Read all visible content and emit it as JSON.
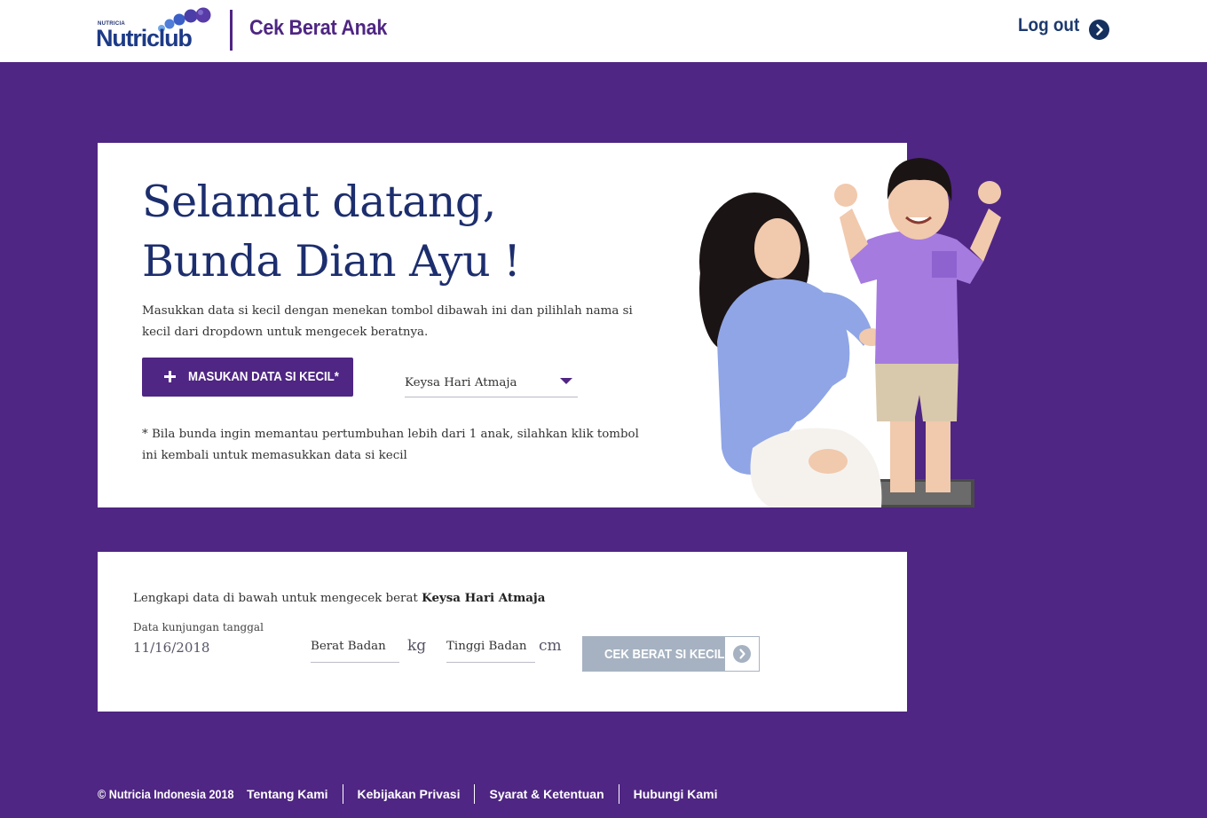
{
  "header": {
    "logo_small": "NUTRICIA",
    "logo_text": "Nutriclub",
    "title": "Cek Berat Anak",
    "logout_label": "Log out",
    "logout_icon": "chevron-right-circle-icon"
  },
  "welcome": {
    "greeting_line1": "Selamat datang,",
    "greeting_line2": "Bunda Dian Ayu !",
    "intro": "Masukkan data si kecil dengan menekan tombol dibawah ini dan pilihlah nama si kecil dari dropdown untuk mengecek beratnya.",
    "add_button_label": "MASUKAN DATA SI KECIL*",
    "add_button_icon": "plus-icon",
    "child_select_value": "Keysa Hari Atmaja",
    "note": "* Bila bunda ingin memantau pertumbuhan lebih dari 1 anak, silahkan klik tombol ini kembali untuk memasukkan data si kecil"
  },
  "form": {
    "intro_prefix": "Lengkapi data di bawah untuk mengecek berat",
    "intro_child_name": "Keysa Hari Atmaja",
    "visit_date_label": "Data kunjungan tanggal",
    "visit_date_value": "11/16/2018",
    "weight_placeholder": "Berat Badan",
    "weight_unit": "kg",
    "height_placeholder": "Tinggi Badan",
    "height_unit": "cm",
    "check_button_label": "CEK BERAT SI KECIL",
    "check_button_icon": "chevron-right-circle-icon"
  },
  "footer": {
    "copyright": "© Nutricia Indonesia 2018",
    "links": [
      "Tentang Kami",
      "Kebijakan Privasi",
      "Syarat & Ketentuan",
      "Hubungi Kami"
    ]
  },
  "colors": {
    "brand_purple": "#4f2683",
    "navy": "#1d2e6e",
    "button_disabled": "#a6b2c1",
    "white": "#ffffff"
  }
}
